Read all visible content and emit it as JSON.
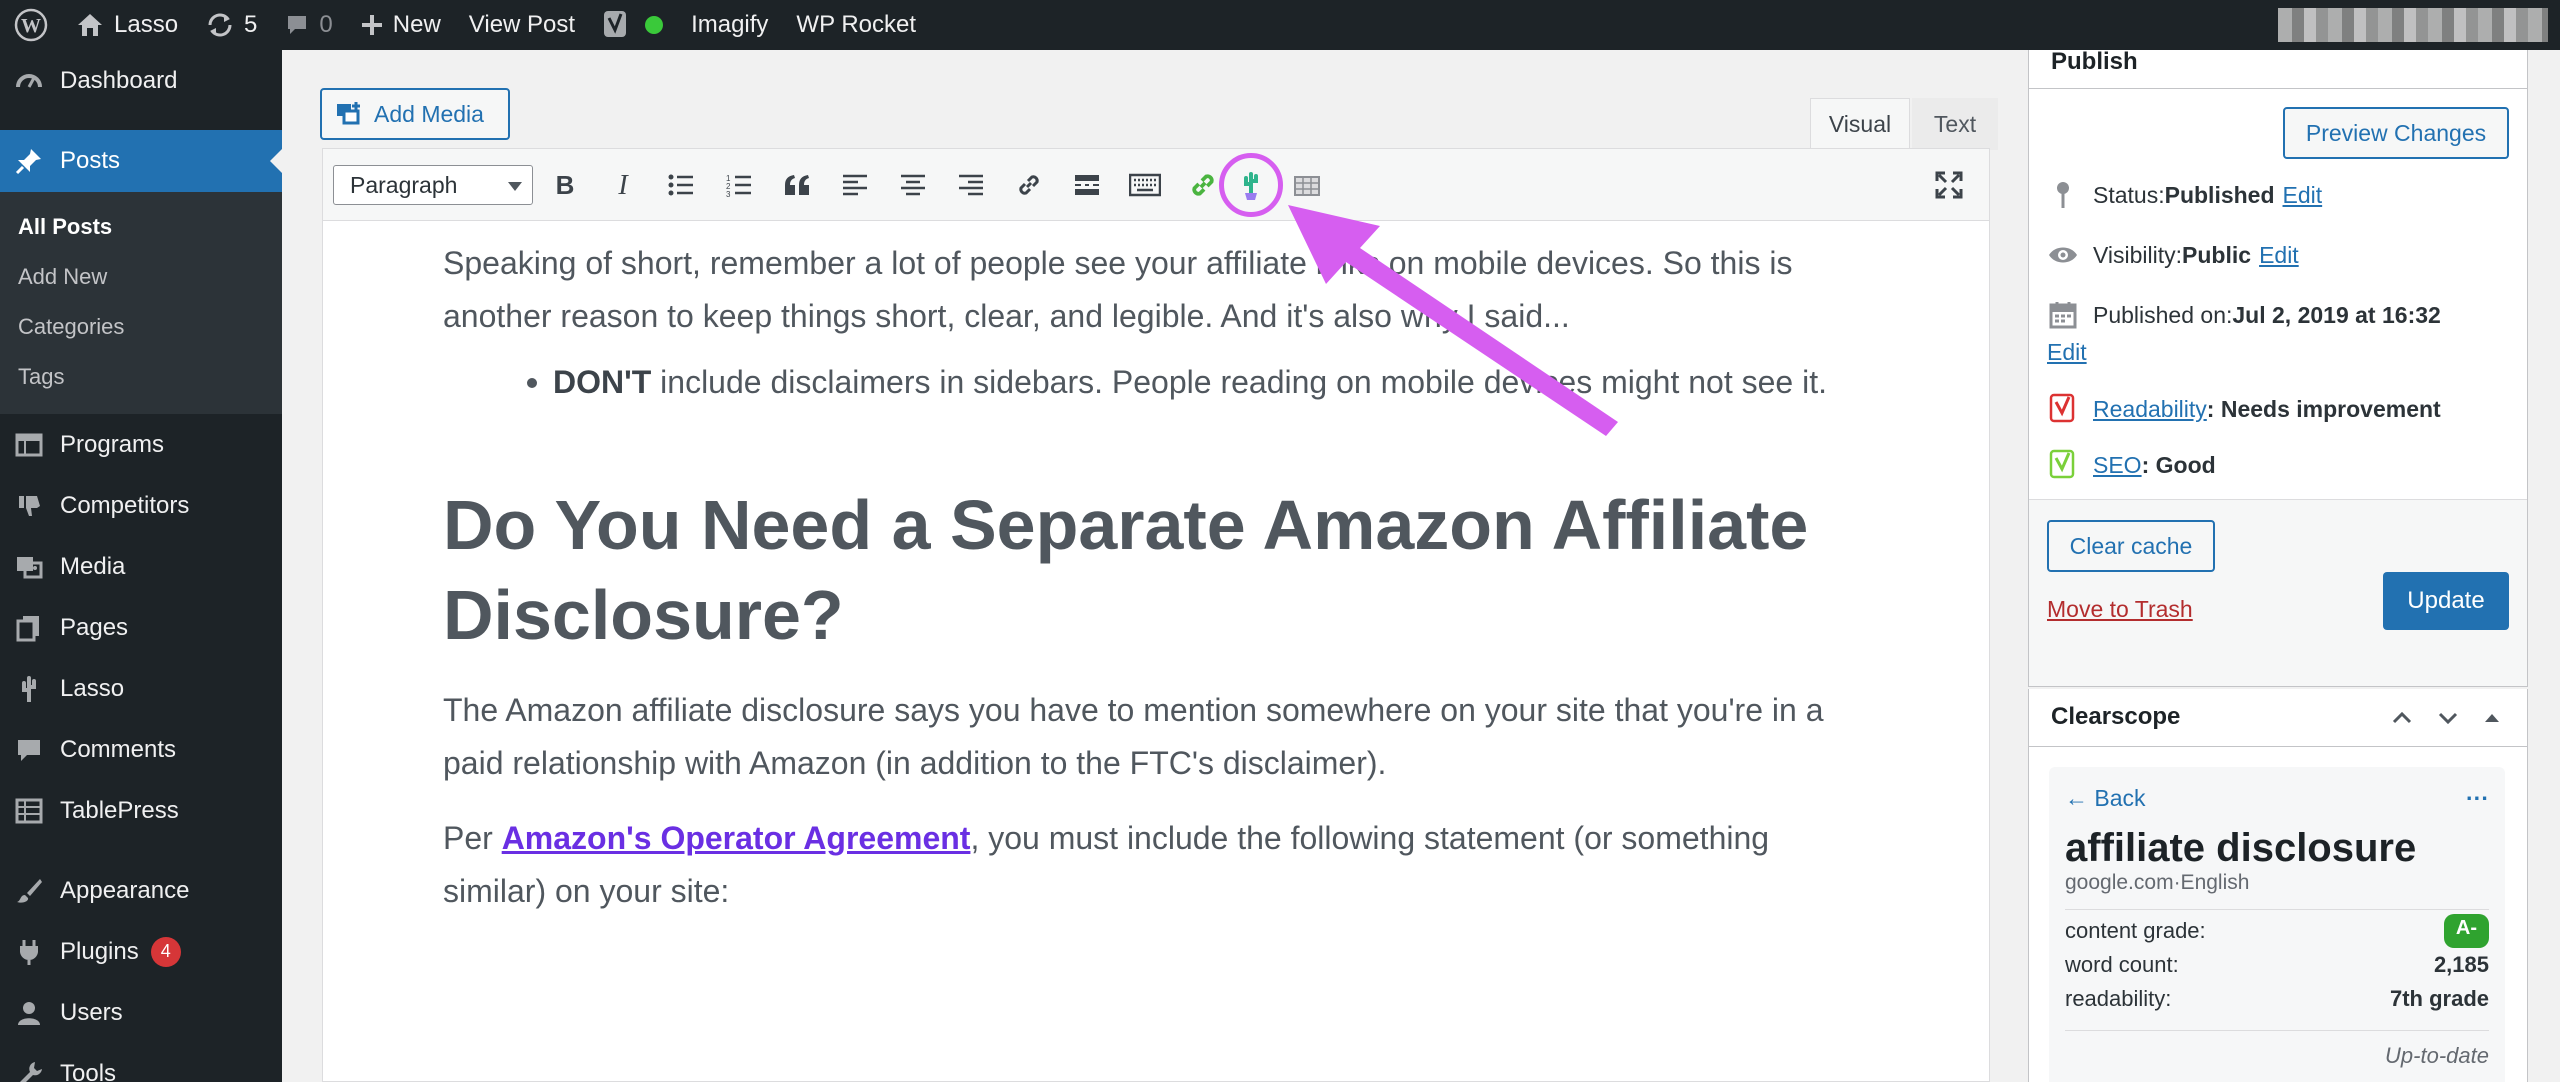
{
  "adminbar": {
    "site_name": "Lasso",
    "updates_count": "5",
    "comments_count": "0",
    "new_label": "New",
    "view_post_label": "View Post",
    "imagify_label": "Imagify",
    "wp_rocket_label": "WP Rocket"
  },
  "sidebar": {
    "dashboard": "Dashboard",
    "posts": "Posts",
    "sub": [
      "All Posts",
      "Add New",
      "Categories",
      "Tags"
    ],
    "programs": "Programs",
    "competitors": "Competitors",
    "media": "Media",
    "pages": "Pages",
    "lasso": "Lasso",
    "comments": "Comments",
    "tablepress": "TablePress",
    "appearance": "Appearance",
    "plugins": "Plugins",
    "plugins_badge": "4",
    "users": "Users",
    "tools": "Tools"
  },
  "editor": {
    "add_media": "Add Media",
    "tab_visual": "Visual",
    "tab_text": "Text",
    "format_value": "Paragraph",
    "para1": "Speaking of short, remember a lot of people see your affiliate links on mobile devices. So this is another reason to keep things short, clear, and legible. And it's also why I said...",
    "bullet_bold": "DON'T",
    "bullet_rest": " include disclaimers in sidebars. People reading on mobile devices might not see it.",
    "heading": "Do You Need a Separate Amazon Affiliate Disclosure?",
    "para2": "The Amazon affiliate disclosure says you have to mention somewhere on your site that you're in a paid relationship with Amazon (in addition to the FTC's disclaimer).",
    "para3_before": "Per ",
    "para3_link": "Amazon's Operator Agreement",
    "para3_after": ", you must include the following statement (or something similar) on your site:"
  },
  "publish": {
    "title": "Publish",
    "preview_changes": "Preview Changes",
    "status_label": "Status: ",
    "status_value": "Published",
    "visibility_label": "Visibility: ",
    "visibility_value": "Public",
    "published_on_label": "Published on: ",
    "published_on_value": "Jul 2, 2019 at 16:32",
    "edit": "Edit",
    "readability_link": "Readability",
    "readability_value": ": Needs improvement",
    "seo_link": "SEO",
    "seo_value": ": Good",
    "clear_cache": "Clear cache",
    "move_to_trash": "Move to Trash",
    "update": "Update"
  },
  "clearscope": {
    "title": "Clearscope",
    "back": "Back",
    "more": "···",
    "keyword": "affiliate disclosure",
    "source": "google.com·English",
    "content_grade_label": "content grade:",
    "content_grade_value": "A-",
    "word_count_label": "word count:",
    "word_count_value": "2,185",
    "readability_label": "readability:",
    "readability_value": "7th grade",
    "status": "Up-to-date"
  },
  "colors": {
    "admin_bg": "#1d2327",
    "accent": "#2271b1",
    "highlight": "#d65ef0",
    "link_purple": "#6a2fe3"
  }
}
